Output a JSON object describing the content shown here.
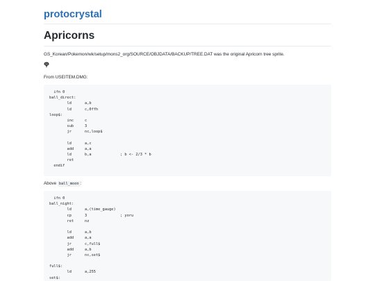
{
  "header": {
    "site_title": "protocrystal"
  },
  "article": {
    "title": "Apricorns",
    "intro": "GS_Korean/Pokemon/wk/setup/mons2_org/SOURCE/OBJDATA/BACKUP/TREE.DAT was the original Apricorn tree sprite.",
    "sprite_icon": "apricorn-tree-sprite",
    "from_text": "From USEITEM.DMG:",
    "code1": [
      "  ifn 0",
      "ball_direct:",
      "        ld      a,b",
      "        ld      c,0ffh",
      "loop$:",
      "        inc     c",
      "        sub     3",
      "        jr      nc,loop$",
      "",
      "        ld      a,c",
      "        add     a,a",
      "        ld      b,a             ; b <- 2/3 * b",
      "        ret",
      "  endif"
    ],
    "above_text": "Above",
    "above_code": "ball_moon",
    "above_suffix": ":",
    "code2": [
      "  ifn 0",
      "ball_night:",
      "        ld      a,(time_gauge)",
      "        cp      3               ; yoru",
      "        ret     nz",
      "",
      "        ld      a,b",
      "        add     a,a",
      "        jr      c,full$",
      "        add     a,b",
      "        jr      nc,set$",
      "",
      "full$:",
      "        ld      a,255",
      "set$:"
    ]
  }
}
